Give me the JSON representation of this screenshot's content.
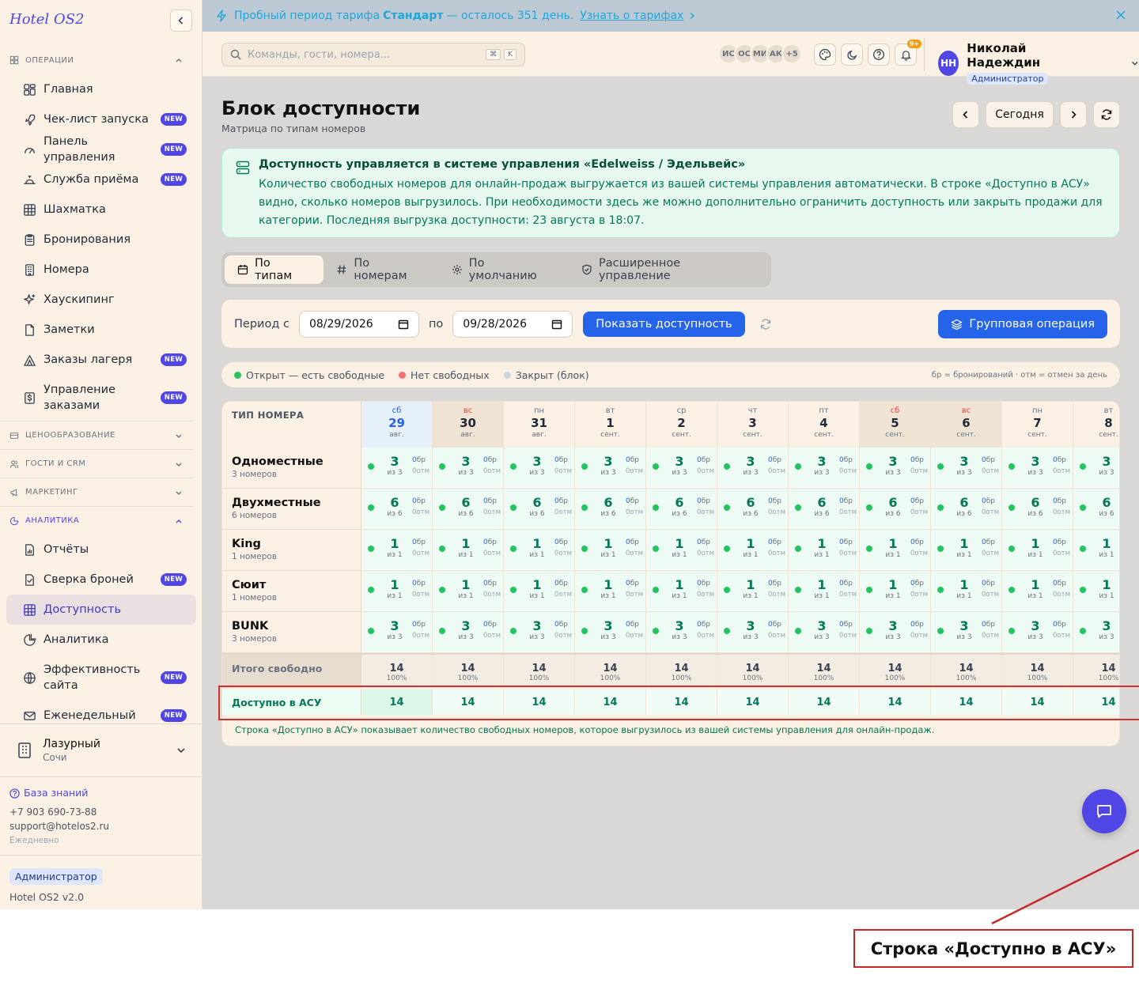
{
  "app": {
    "logo": "Hotel OS2"
  },
  "banner": {
    "text_a": "Пробный период тарифа",
    "plan": "Стандарт",
    "text_b": "— осталось 351 день.",
    "link": "Узнать о тарифах"
  },
  "sidebar": {
    "sections": [
      {
        "label": "Операции",
        "icon": "grid-icon",
        "open": true,
        "items": [
          {
            "label": "Главная",
            "icon": "dashboard-icon"
          },
          {
            "label": "Чек-лист запуска",
            "icon": "rocket-icon",
            "badge": "NEW"
          },
          {
            "label": "Панель управления",
            "icon": "gauge-icon",
            "badge": "NEW"
          },
          {
            "label": "Служба приёма",
            "icon": "bell-desk-icon",
            "badge": "NEW"
          },
          {
            "label": "Шахматка",
            "icon": "table-icon"
          },
          {
            "label": "Бронирования",
            "icon": "clipboard-icon"
          },
          {
            "label": "Номера",
            "icon": "building-icon"
          },
          {
            "label": "Хаускипинг",
            "icon": "sparkle-icon"
          },
          {
            "label": "Заметки",
            "icon": "note-icon"
          },
          {
            "label": "Заказы лагеря",
            "icon": "tent-icon",
            "badge": "NEW"
          },
          {
            "label": "Управление заказами",
            "icon": "dollar-icon",
            "badge": "NEW",
            "tall": true
          }
        ]
      },
      {
        "label": "Ценообразование",
        "icon": "card-icon",
        "open": false,
        "items": []
      },
      {
        "label": "Гости и CRM",
        "icon": "users-icon",
        "open": false,
        "items": []
      },
      {
        "label": "Маркетинг",
        "icon": "megaphone-icon",
        "open": false,
        "items": []
      },
      {
        "label": "Аналитика",
        "icon": "chart-icon",
        "open": true,
        "items": [
          {
            "label": "Отчёты",
            "icon": "file-chart-icon"
          },
          {
            "label": "Сверка броней",
            "icon": "file-check-icon",
            "badge": "NEW"
          },
          {
            "label": "Доступность",
            "icon": "table-icon",
            "active": true
          },
          {
            "label": "Аналитика",
            "icon": "pie-icon"
          },
          {
            "label": "Эффективность сайта",
            "icon": "globe-icon",
            "badge": "NEW",
            "tall": true
          },
          {
            "label": "Еженедельный",
            "icon": "mail-icon",
            "badge": "NEW"
          }
        ]
      }
    ],
    "hotel": {
      "name": "Лазурный",
      "city": "Сочи"
    },
    "support": {
      "kb": "База знаний",
      "phone": "+7 903 690-73-88",
      "email": "support@hotelos2.ru",
      "hours": "Ежедневно"
    },
    "role": "Администратор",
    "version": "Hotel OS2 v2.0"
  },
  "topbar": {
    "search_placeholder": "Команды, гости, номера...",
    "kbd": [
      "⌘",
      "K"
    ],
    "avatars": [
      "ИС",
      "ОС",
      "МИ",
      "АК",
      "+5"
    ],
    "notif_badge": "9+",
    "user": {
      "initials": "НН",
      "name": "Николай Надеждин",
      "role": "Администратор"
    }
  },
  "page": {
    "title": "Блок доступности",
    "subtitle": "Матрица по типам номеров",
    "today": "Сегодня",
    "info_title": "Доступность управляется в системе управления «Edelweiss / Эдельвейс»",
    "info_body": "Количество свободных номеров для онлайн-продаж выгружается из вашей системы управления автоматически. В строке «Доступно в АСУ» видно, сколько номеров выгрузилось. При необходимости здесь же можно дополнительно ограничить доступность или закрыть продажи для категории. Последняя выгрузка доступности: 23 августа в 18:07.",
    "tabs": [
      "По типам",
      "По номерам",
      "По умолчанию",
      "Расширенное управление"
    ],
    "filter": {
      "from_label": "Период с",
      "from": "08/29/2026",
      "to_label": "по",
      "to": "09/28/2026",
      "show": "Показать доступность",
      "group": "Групповая операция"
    },
    "legend": {
      "open": "Открыт — есть свободные",
      "none": "Нет свободных",
      "closed": "Закрыт (блок)",
      "note": "бр = бронирований · отм = отмен за день"
    },
    "colors": {
      "open": "#22c55e",
      "none": "#f87171",
      "closed": "#cbd5e1",
      "accent": "#2563eb",
      "brand": "#4f46e5"
    }
  },
  "grid": {
    "type_header": "ТИП НОМЕРА",
    "days": [
      {
        "dow": "сб",
        "day": "29",
        "mon": "авг.",
        "today": true
      },
      {
        "dow": "вс",
        "day": "30",
        "mon": "авг.",
        "weekend": true
      },
      {
        "dow": "пн",
        "day": "31",
        "mon": "авг."
      },
      {
        "dow": "вт",
        "day": "1",
        "mon": "сент."
      },
      {
        "dow": "ср",
        "day": "2",
        "mon": "сент."
      },
      {
        "dow": "чт",
        "day": "3",
        "mon": "сент."
      },
      {
        "dow": "пт",
        "day": "4",
        "mon": "сент."
      },
      {
        "dow": "сб",
        "day": "5",
        "mon": "сент.",
        "weekend": true
      },
      {
        "dow": "вс",
        "day": "6",
        "mon": "сент.",
        "weekend": true
      },
      {
        "dow": "пн",
        "day": "7",
        "mon": "сент."
      },
      {
        "dow": "вт",
        "day": "8",
        "mon": "сент."
      }
    ],
    "rows": [
      {
        "name": "Одноместные",
        "count": "3 номеров",
        "free": "3",
        "of": "из 3"
      },
      {
        "name": "Двухместные",
        "count": "6 номеров",
        "free": "6",
        "of": "из 6"
      },
      {
        "name": "King",
        "count": "1 номеров",
        "free": "1",
        "of": "из 1"
      },
      {
        "name": "Сюит",
        "count": "1 номеров",
        "free": "1",
        "of": "из 1"
      },
      {
        "name": "BUNK",
        "count": "3 номеров",
        "free": "3",
        "of": "из 3"
      }
    ],
    "cell_bookings": "0",
    "cell_bookings_unit": "бр",
    "cell_cancels": "0",
    "cell_cancels_unit": "отм",
    "total_label": "Итого свободно",
    "total_value": "14",
    "total_pct": "100%",
    "asu_label": "Доступно в АСУ",
    "asu_value": "14",
    "note": "Строка «Доступно в АСУ» показывает количество свободных номеров, которое выгрузилось из вашей системы управления для онлайн-продаж."
  },
  "annotation": {
    "callout": "Строка «Доступно в АСУ»"
  }
}
